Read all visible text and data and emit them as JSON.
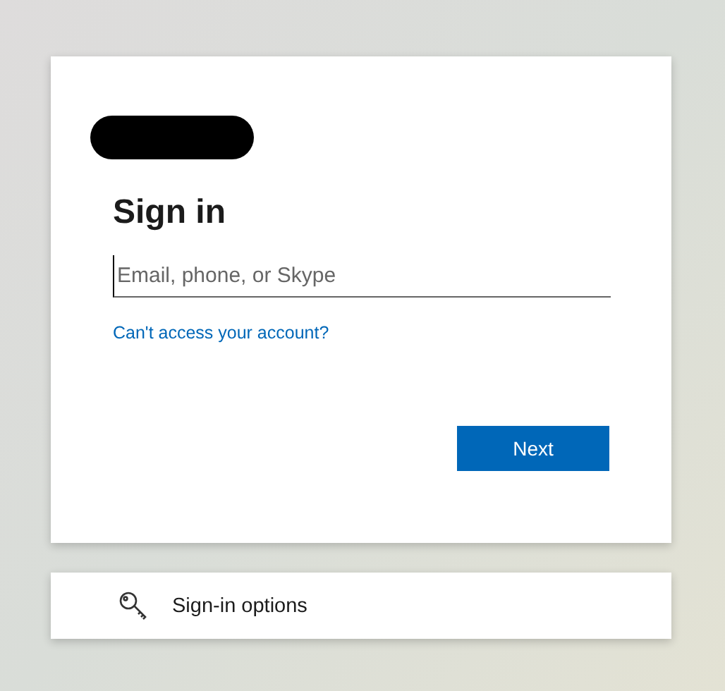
{
  "heading": "Sign in",
  "email_field": {
    "placeholder": "Email, phone, or Skype"
  },
  "link": "Can't access your account?",
  "buttons": [
    "Next"
  ],
  "options": {
    "label": "Sign-in options"
  }
}
